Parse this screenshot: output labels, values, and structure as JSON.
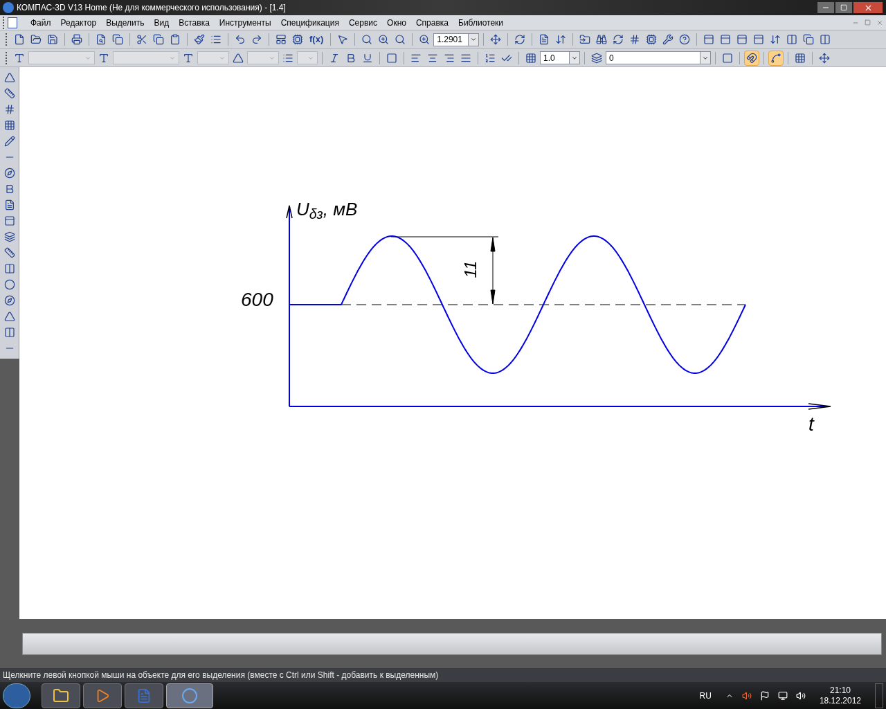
{
  "window": {
    "title": "КОМПАС-3D V13 Home (Не для коммерческого использования) - [1.4]"
  },
  "menu": [
    "Файл",
    "Редактор",
    "Выделить",
    "Вид",
    "Вставка",
    "Инструменты",
    "Спецификация",
    "Сервис",
    "Окно",
    "Справка",
    "Библиотеки"
  ],
  "toolbar": {
    "formula_button": "f(x)",
    "zoom_value": "1.2901",
    "step_value": "1.0",
    "layer_value": "0"
  },
  "snap_buttons": [
    {
      "kind": "magnet",
      "on": true
    },
    {
      "kind": "point-snap",
      "on": true
    }
  ],
  "drawing": {
    "y_axis_label": "U$_{δз}$, мВ",
    "level_label": "600",
    "dimension": "11",
    "x_axis_label": "t"
  },
  "status_bar": "Щелкните левой кнопкой мыши на объекте для его выделения (вместе с Ctrl или Shift - добавить к выделенным)",
  "taskbar": {
    "language": "RU",
    "time": "21:10",
    "date": "18.12.2012"
  }
}
